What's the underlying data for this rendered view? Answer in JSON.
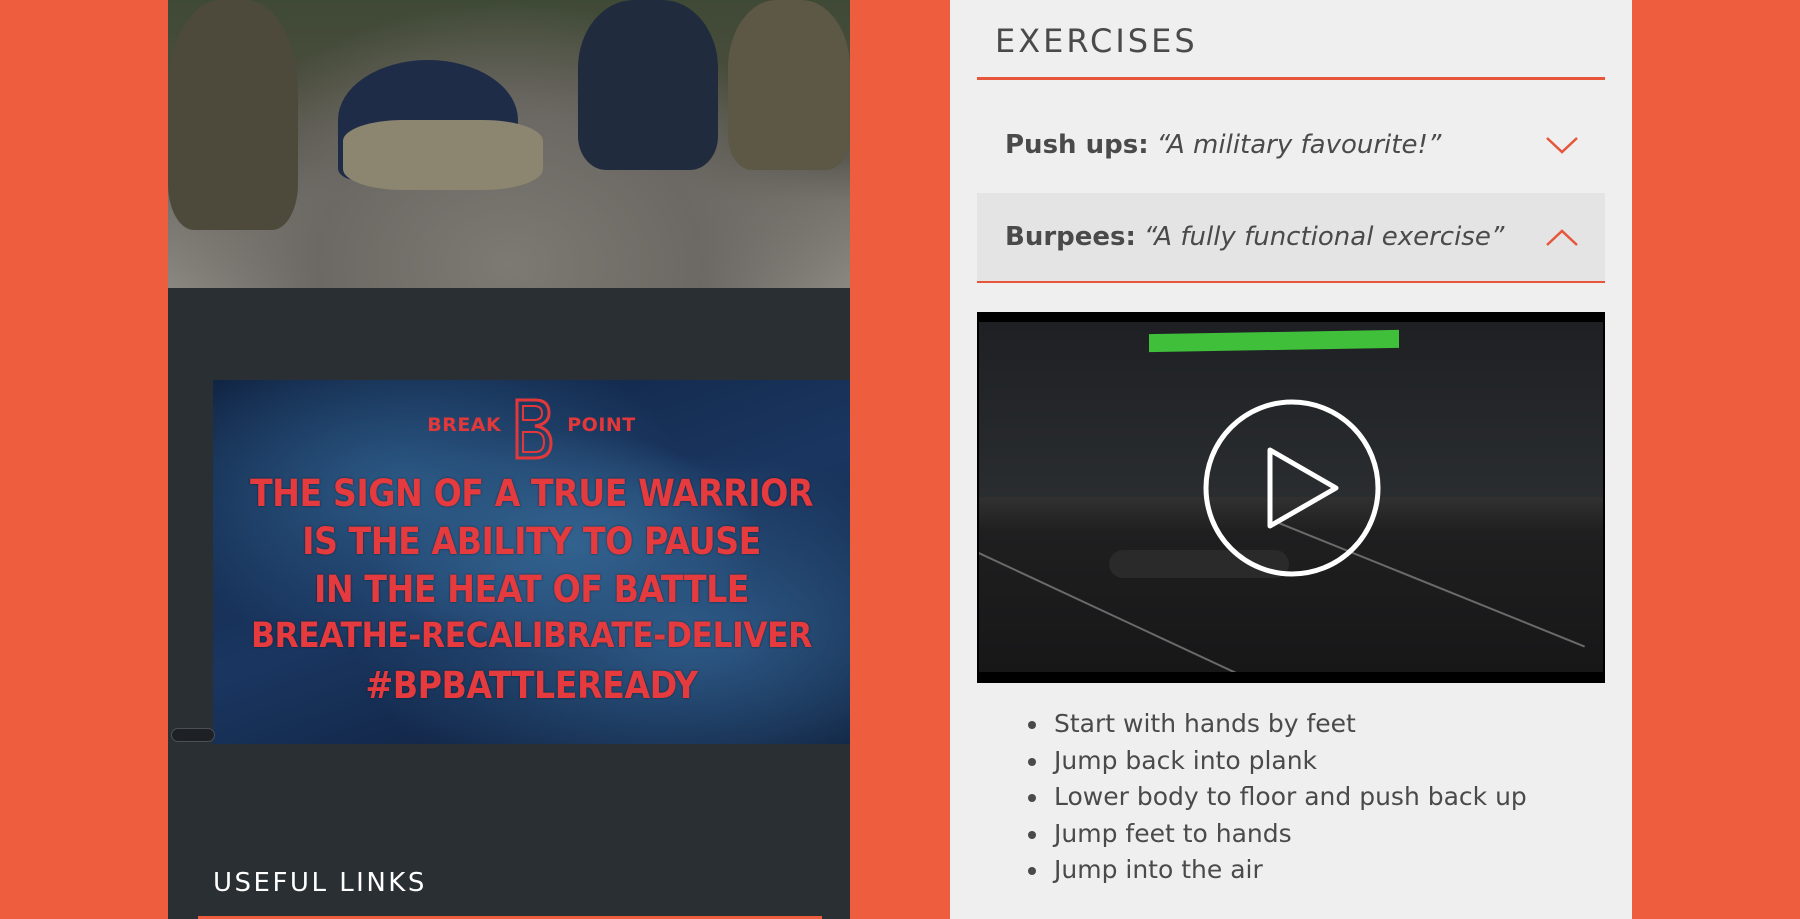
{
  "left": {
    "poster": {
      "brand_left": "BREAK",
      "brand_right": "POINT",
      "lines": [
        "THE SIGN OF A TRUE WARRIOR",
        "IS THE ABILITY TO PAUSE",
        "IN THE HEAT OF BATTLE",
        "BREATHE-RECALIBRATE-DELIVER",
        "#BPBATTLEREADY"
      ]
    },
    "useful_links_title": "USEFUL LINKS"
  },
  "exercises": {
    "title": "EXERCISES",
    "items": [
      {
        "name": "Push ups:",
        "quote": "“A military favourite!”",
        "expanded": false,
        "chevron": "chevron-down-icon"
      },
      {
        "name": "Burpees:",
        "quote": "“A fully functional exercise”",
        "expanded": true,
        "chevron": "chevron-up-icon"
      }
    ],
    "steps": [
      "Start with hands by feet",
      "Jump back into plank",
      "Lower body to floor and push back up",
      "Jump feet to hands",
      "Jump into the air"
    ]
  },
  "colors": {
    "accent": "#ee5d3d",
    "dark_panel": "#2a2f34",
    "light_panel": "#efefef",
    "text": "#4a4a4a",
    "poster_text": "#e53a3e"
  }
}
